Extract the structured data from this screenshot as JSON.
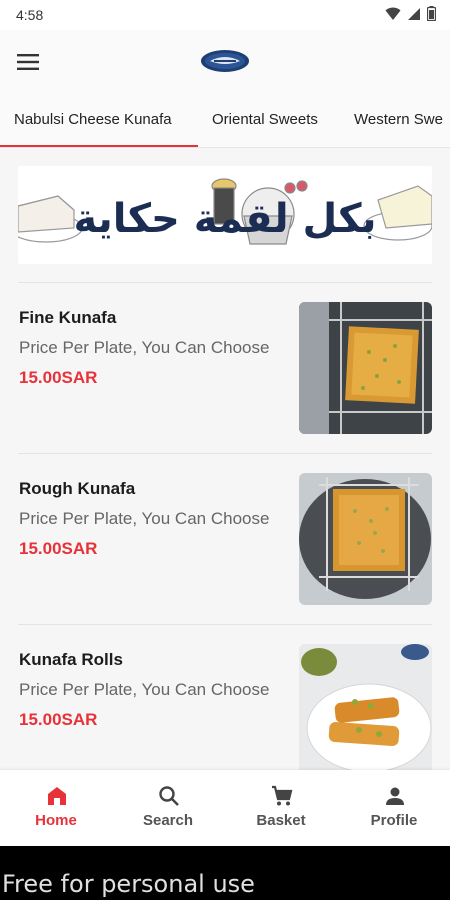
{
  "status_bar": {
    "time": "4:58"
  },
  "tabs": [
    {
      "label": "Nabulsi Cheese Kunafa",
      "active": true
    },
    {
      "label": "Oriental Sweets",
      "active": false
    },
    {
      "label": "Western Swe",
      "active": false
    }
  ],
  "banner": {
    "text": "بكل لقمة حكاية"
  },
  "products": [
    {
      "name": "Fine Kunafa",
      "description": "Price Per Plate, You Can Choose",
      "price": "15.00SAR"
    },
    {
      "name": "Rough Kunafa",
      "description": "Price Per Plate, You Can Choose",
      "price": "15.00SAR"
    },
    {
      "name": "Kunafa Rolls",
      "description": "Price Per Plate, You Can Choose",
      "price": "15.00SAR"
    }
  ],
  "bottom_nav": [
    {
      "label": "Home",
      "icon": "home-icon",
      "active": true
    },
    {
      "label": "Search",
      "icon": "search-icon",
      "active": false
    },
    {
      "label": "Basket",
      "icon": "cart-icon",
      "active": false
    },
    {
      "label": "Profile",
      "icon": "person-icon",
      "active": false
    }
  ],
  "watermark": "Free for personal use",
  "colors": {
    "accent": "#e8323a",
    "text": "#1c1c1c",
    "muted": "#666666",
    "background": "#f6f6f6"
  }
}
